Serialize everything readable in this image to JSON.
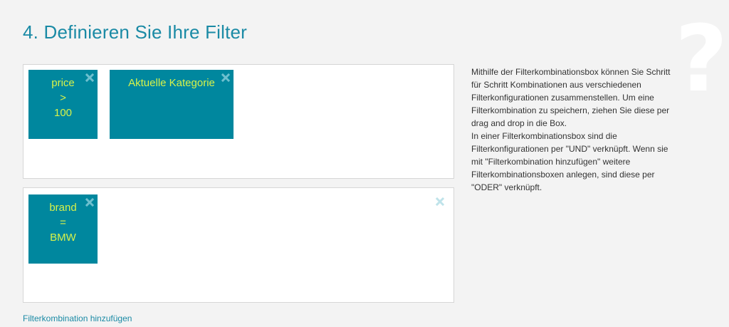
{
  "page": {
    "title": "4. Definieren Sie Ihre Filter",
    "help_symbol": "?"
  },
  "filter_boxes": [
    {
      "chips": [
        {
          "lines": [
            "price",
            ">",
            "100"
          ],
          "remove_icon": "close-icon"
        },
        {
          "lines": [
            "Aktuelle Kategorie"
          ],
          "remove_icon": "close-icon"
        }
      ]
    },
    {
      "chips": [
        {
          "lines": [
            "brand",
            "=",
            "BMW"
          ],
          "remove_icon": "close-icon"
        }
      ],
      "remove_icon": "close-icon"
    }
  ],
  "description": {
    "paragraph1": "Mithilfe der Filterkombinationsbox können Sie Schritt für Schritt Kombinationen aus verschiedenen Filterkonfigurationen zusammenstellen. Um eine Filterkombination zu speichern, ziehen Sie diese per drag and drop in die Box.",
    "paragraph2": "In einer Filterkombinationsbox sind die Filterkonfigurationen per \"UND\" verknüpft. Wenn sie mit \"Filterkombination hinzufügen\" weitere Filterkombinationsboxen anlegen, sind diese per \"ODER\" verknüpft."
  },
  "actions": {
    "add_combination": "Filterkombination hinzufügen"
  },
  "colors": {
    "chip_background": "#00879e",
    "chip_text": "#d7f24a",
    "chip_remove": "#6fc0cf",
    "box_remove": "#bfe3ea",
    "heading": "#1a8aa5",
    "link": "#1a8aa5"
  }
}
